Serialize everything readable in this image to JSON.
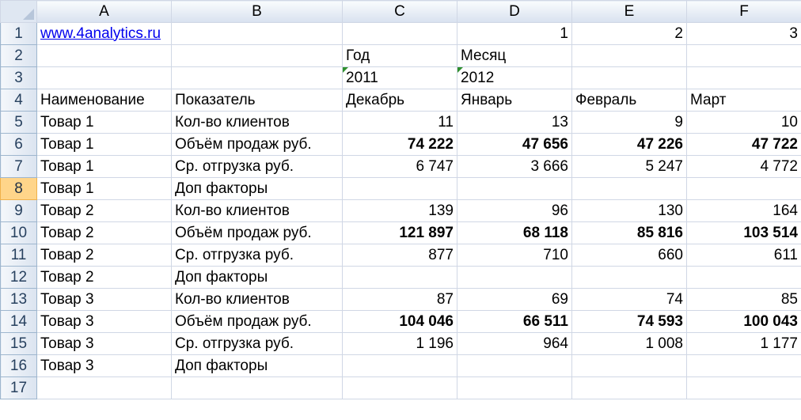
{
  "columns": [
    "A",
    "B",
    "C",
    "D",
    "E",
    "F"
  ],
  "cells": {
    "r1": {
      "row": "1",
      "A": "www.4analytics.ru",
      "B": "",
      "C": "",
      "D": "1",
      "E": "2",
      "F": "3"
    },
    "r2": {
      "row": "2",
      "A": "",
      "B": "",
      "C": "Год",
      "D": "Месяц",
      "E": "",
      "F": ""
    },
    "r3": {
      "row": "3",
      "A": "",
      "B": "",
      "C": "2011",
      "D": "2012",
      "E": "",
      "F": ""
    },
    "r4": {
      "row": "4",
      "A": "Наименование",
      "B": "Показатель",
      "C": "Декабрь",
      "D": "Январь",
      "E": "Февраль",
      "F": "Март"
    },
    "r5": {
      "row": "5",
      "A": "Товар 1",
      "B": "Кол-во клиентов",
      "C": "11",
      "D": "13",
      "E": "9",
      "F": "10"
    },
    "r6": {
      "row": "6",
      "A": "Товар 1",
      "B": "Объём продаж руб.",
      "C": "74 222",
      "D": "47 656",
      "E": "47 226",
      "F": "47 722"
    },
    "r7": {
      "row": "7",
      "A": "Товар 1",
      "B": "Ср. отгрузка руб.",
      "C": "6 747",
      "D": "3 666",
      "E": "5 247",
      "F": "4 772"
    },
    "r8": {
      "row": "8",
      "A": "Товар 1",
      "B": "Доп факторы",
      "C": "",
      "D": "",
      "E": "",
      "F": ""
    },
    "r9": {
      "row": "9",
      "A": "Товар 2",
      "B": "Кол-во клиентов",
      "C": "139",
      "D": "96",
      "E": "130",
      "F": "164"
    },
    "r10": {
      "row": "10",
      "A": "Товар 2",
      "B": "Объём продаж руб.",
      "C": "121 897",
      "D": "68 118",
      "E": "85 816",
      "F": "103 514"
    },
    "r11": {
      "row": "11",
      "A": "Товар 2",
      "B": "Ср. отгрузка руб.",
      "C": "877",
      "D": "710",
      "E": "660",
      "F": "611"
    },
    "r12": {
      "row": "12",
      "A": "Товар 2",
      "B": "Доп факторы",
      "C": "",
      "D": "",
      "E": "",
      "F": ""
    },
    "r13": {
      "row": "13",
      "A": "Товар 3",
      "B": "Кол-во клиентов",
      "C": "87",
      "D": "69",
      "E": "74",
      "F": "85"
    },
    "r14": {
      "row": "14",
      "A": "Товар 3",
      "B": "Объём продаж руб.",
      "C": "104 046",
      "D": "66 511",
      "E": "74 593",
      "F": "100 043"
    },
    "r15": {
      "row": "15",
      "A": "Товар 3",
      "B": "Ср. отгрузка руб.",
      "C": "1 196",
      "D": "964",
      "E": "1 008",
      "F": "1 177"
    },
    "r16": {
      "row": "16",
      "A": "Товар 3",
      "B": "Доп факторы",
      "C": "",
      "D": "",
      "E": "",
      "F": ""
    },
    "r17": {
      "row": "17",
      "A": "",
      "B": "",
      "C": "",
      "D": "",
      "E": "",
      "F": ""
    }
  },
  "active_row": "8",
  "colors": {
    "header_bg": "#dbe4f0",
    "active_row_header": "#ffd58a",
    "value_blue": "#1f1f9a",
    "link": "#0000ee",
    "text_as_number_marker": "#2f8f2f"
  }
}
